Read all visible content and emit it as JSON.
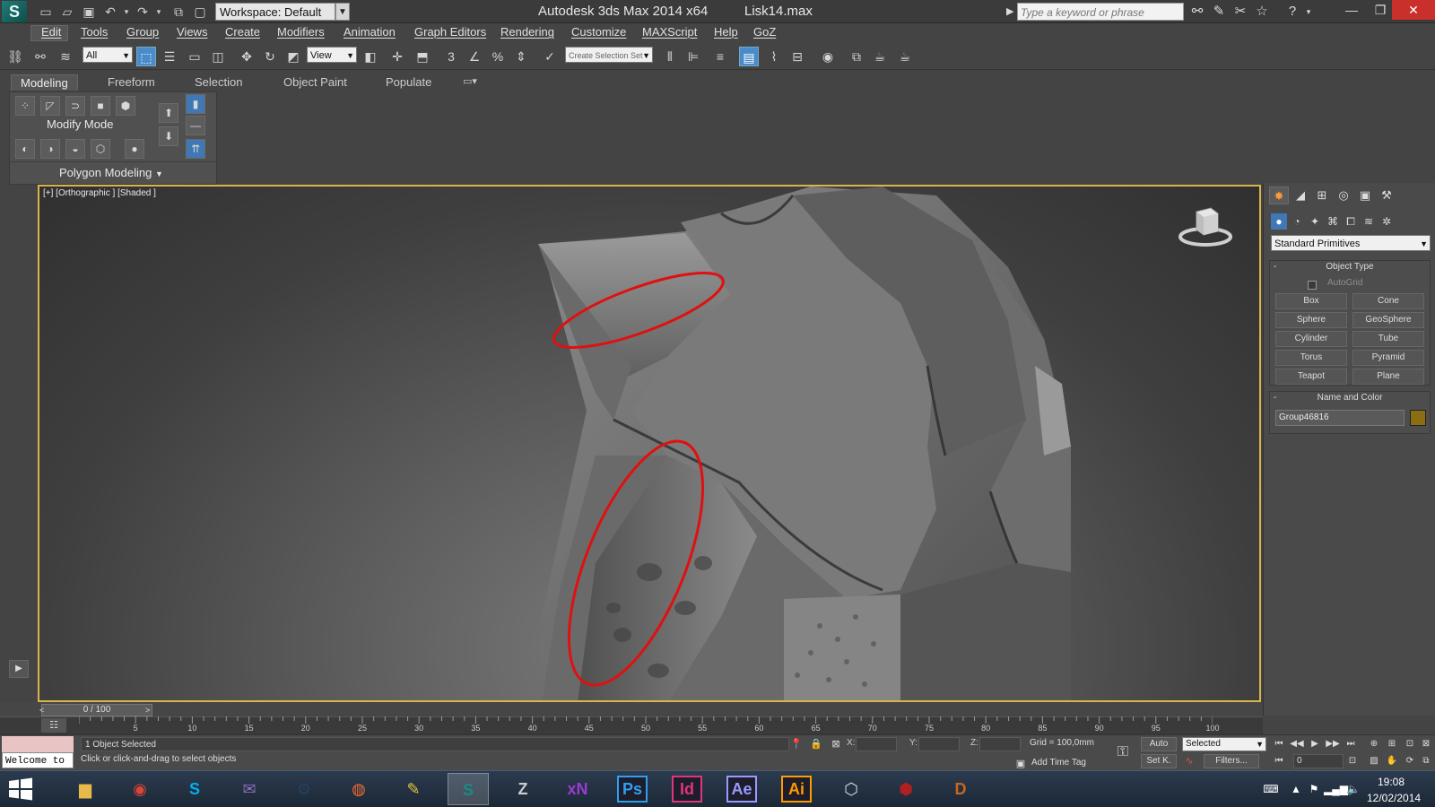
{
  "titlebar": {
    "workspace": "Workspace: Default",
    "app_title": "Autodesk 3ds Max  2014 x64",
    "file_name": "Lisk14.max",
    "search_placeholder": "Type a keyword or phrase"
  },
  "menu": [
    "Edit",
    "Tools",
    "Group",
    "Views",
    "Create",
    "Modifiers",
    "Animation",
    "Graph Editors",
    "Rendering",
    "Customize",
    "MAXScript",
    "Help",
    "GoZ"
  ],
  "toolbar": {
    "filter_value": "All",
    "refcoord_value": "View",
    "selection_set_placeholder": "Create Selection Set"
  },
  "ribbon": {
    "tabs": [
      "Modeling",
      "Freeform",
      "Selection",
      "Object Paint",
      "Populate"
    ],
    "active_tab": "Modeling",
    "mode_label": "Modify Mode",
    "section_label": "Polygon Modeling"
  },
  "viewport": {
    "label": "[+] [Orthographic ] [Shaded ]",
    "accent_color": "#d9b44a",
    "annotation_color": "#e01010"
  },
  "command_panel": {
    "category": "Standard Primitives",
    "object_type_title": "Object Type",
    "autogrid_label": "AutoGrid",
    "primitives": [
      "Box",
      "Cone",
      "Sphere",
      "GeoSphere",
      "Cylinder",
      "Tube",
      "Torus",
      "Pyramid",
      "Teapot",
      "Plane"
    ],
    "name_color_title": "Name and Color",
    "object_name": "Group46816",
    "object_color": "#8b6d14"
  },
  "timeline": {
    "slider_text": "0 / 100",
    "ticks": [
      "5",
      "10",
      "15",
      "20",
      "25",
      "30",
      "35",
      "40",
      "45",
      "50",
      "55",
      "60",
      "65",
      "70",
      "75",
      "80",
      "85",
      "90",
      "95",
      "100"
    ]
  },
  "status": {
    "listener_text": "Welcome to",
    "selection_text": "1 Object Selected",
    "prompt_text": "Click or click-and-drag to select objects",
    "coord_x_label": "X:",
    "coord_y_label": "Y:",
    "coord_z_label": "Z:",
    "grid_text": "Grid = 100,0mm",
    "add_time_tag": "Add Time Tag",
    "auto_label": "Auto",
    "setk_label": "Set K.",
    "selected_dd": "Selected",
    "filters_label": "Filters...",
    "frame_value": "0"
  },
  "taskbar": {
    "time": "19:08",
    "date": "12/02/2014",
    "apps": [
      {
        "name": "file-explorer",
        "label": "",
        "color": "#e8b94a"
      },
      {
        "name": "chrome",
        "label": "",
        "color": "#db4437"
      },
      {
        "name": "skype",
        "label": "S",
        "color": "#00aff0"
      },
      {
        "name": "pidgin",
        "label": "",
        "color": "#8a6fb5"
      },
      {
        "name": "steam",
        "label": "",
        "color": "#2a3f5a"
      },
      {
        "name": "origin",
        "label": "",
        "color": "#f56c2d"
      },
      {
        "name": "illustrator-pro",
        "label": "",
        "color": "#e8c43a"
      },
      {
        "name": "3ds-max",
        "label": "",
        "color": "#1a8a84"
      },
      {
        "name": "zbrush",
        "label": "",
        "color": "#cccccc"
      },
      {
        "name": "xnormal",
        "label": "xN",
        "color": "#9b3bd1"
      },
      {
        "name": "photoshop",
        "label": "Ps",
        "color": "#2da0f0"
      },
      {
        "name": "indesign",
        "label": "Id",
        "color": "#e0347c"
      },
      {
        "name": "after-effects",
        "label": "Ae",
        "color": "#9999ff"
      },
      {
        "name": "illustrator",
        "label": "Ai",
        "color": "#ff9a00"
      },
      {
        "name": "unity",
        "label": "",
        "color": "#dddddd"
      },
      {
        "name": "game-app",
        "label": "",
        "color": "#b02020"
      },
      {
        "name": "diablo",
        "label": "D",
        "color": "#c8661a"
      }
    ]
  }
}
